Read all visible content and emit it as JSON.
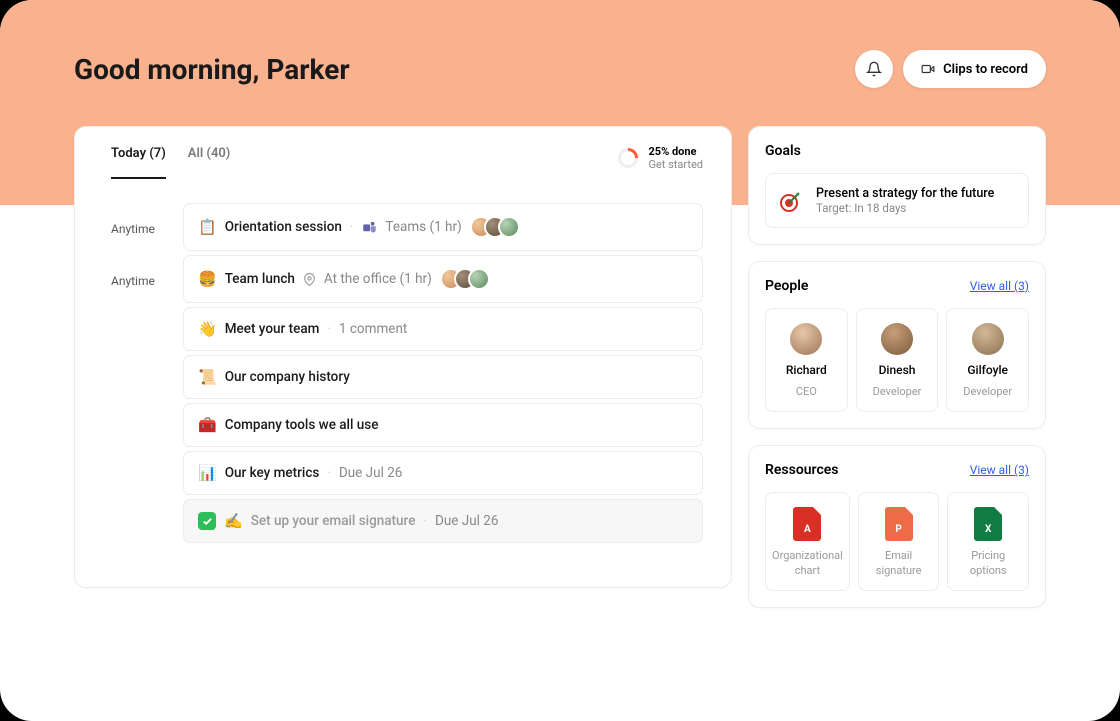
{
  "greeting": "Good morning, Parker",
  "header": {
    "clips_label": "Clips to record"
  },
  "tabs": {
    "today": "Today (7)",
    "all": "All (40)"
  },
  "progress": {
    "pct_label": "25% done",
    "sub_label": "Get started"
  },
  "tasks": [
    {
      "time": "Anytime",
      "emoji": "📋",
      "title": "Orientation session",
      "meta_prefix": "Teams (1 hr)",
      "has_teams": true,
      "avatars": 3
    },
    {
      "time": "Anytime",
      "emoji": "🍔",
      "title": "Team lunch",
      "location": "At the office (1 hr)",
      "avatars": 3
    },
    {
      "emoji": "👋",
      "title": "Meet your team",
      "comments": "1 comment"
    },
    {
      "emoji": "📜",
      "title": "Our company history"
    },
    {
      "emoji": "🧰",
      "title": "Company tools we all use"
    },
    {
      "emoji": "📊",
      "title": "Our key metrics",
      "due": "Due Jul 26"
    },
    {
      "emoji": "✍️",
      "title": "Set up your email signature",
      "due": "Due Jul 26",
      "completed": true
    }
  ],
  "goals": {
    "title": "Goals",
    "item": {
      "title": "Present a strategy for the future",
      "target": "Target: In 18 days"
    }
  },
  "people": {
    "title": "People",
    "view_all": "View all (3)",
    "items": [
      {
        "name": "Richard",
        "role": "CEO"
      },
      {
        "name": "Dinesh",
        "role": "Developer"
      },
      {
        "name": "Gilfoyle",
        "role": "Developer"
      }
    ]
  },
  "resources": {
    "title": "Ressources",
    "view_all": "View all (3)",
    "items": [
      {
        "name": "Organizational chart",
        "type": "pdf"
      },
      {
        "name": "Email signature",
        "type": "ppt"
      },
      {
        "name": "Pricing options",
        "type": "xls"
      }
    ]
  }
}
